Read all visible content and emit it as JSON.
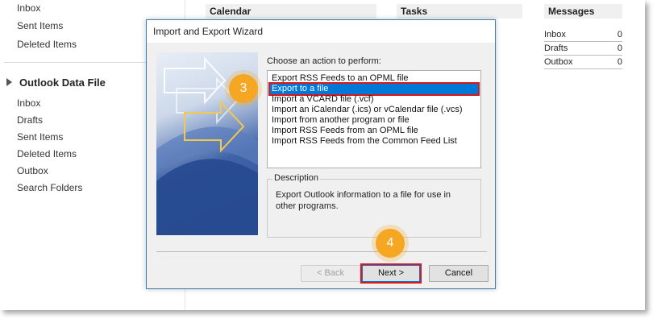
{
  "sidebar": {
    "top_items": [
      {
        "label": "Inbox"
      },
      {
        "label": "Sent Items"
      },
      {
        "label": "Deleted Items"
      }
    ],
    "section": {
      "title": "Outlook Data File"
    },
    "section_items": [
      {
        "label": "Inbox"
      },
      {
        "label": "Drafts"
      },
      {
        "label": "Sent Items"
      },
      {
        "label": "Deleted Items"
      },
      {
        "label": "Outbox"
      },
      {
        "label": "Search Folders"
      }
    ]
  },
  "panels": {
    "calendar": "Calendar",
    "tasks": "Tasks",
    "messages": "Messages"
  },
  "messages_table": [
    {
      "label": "Inbox",
      "count": "0"
    },
    {
      "label": "Drafts",
      "count": "0"
    },
    {
      "label": "Outbox",
      "count": "0"
    }
  ],
  "dialog": {
    "title": "Import and Export Wizard",
    "choose_label": "Choose an action to perform:",
    "actions": [
      {
        "label": "Export RSS Feeds to an OPML file",
        "selected": false
      },
      {
        "label": "Export to a file",
        "selected": true
      },
      {
        "label": "Import a VCARD file (.vcf)",
        "selected": false
      },
      {
        "label": "Import an iCalendar (.ics) or vCalendar file (.vcs)",
        "selected": false
      },
      {
        "label": "Import from another program or file",
        "selected": false
      },
      {
        "label": "Import RSS Feeds from an OPML file",
        "selected": false
      },
      {
        "label": "Import RSS Feeds from the Common Feed List",
        "selected": false
      }
    ],
    "description_label": "Description",
    "description_text": "Export Outlook information to a file for use in other programs.",
    "buttons": {
      "back": "< Back",
      "next": "Next >",
      "cancel": "Cancel"
    }
  },
  "annotations": {
    "step3": "3",
    "step4": "4"
  },
  "colors": {
    "selection": "#0078d7",
    "highlight_box": "#e01515",
    "badge": "#f5a623"
  }
}
